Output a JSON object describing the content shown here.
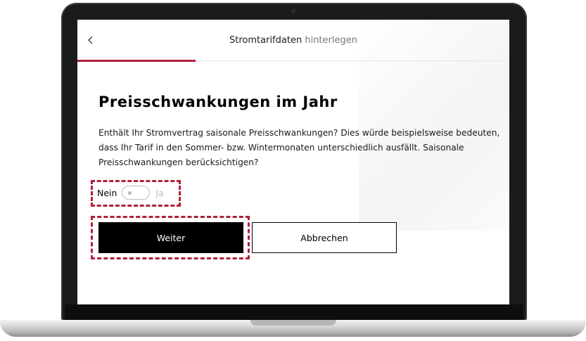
{
  "header": {
    "title_main": "Stromtarifdaten",
    "title_sub": "hinterlegen"
  },
  "icons": {
    "back": "chevron-left-icon"
  },
  "content": {
    "heading": "Preisschwankungen im Jahr",
    "description": "Enthält Ihr Stromvertrag saisonale Preisschwankungen? Dies würde beispielsweise bedeuten, dass Ihr Tarif in den Sommer- bzw. Wintermonaten unterschiedlich ausfällt. Saisonale Preisschwankungen berücksichtigen?"
  },
  "toggle": {
    "off_label": "Nein",
    "on_label": "Ja",
    "state": "Nein"
  },
  "buttons": {
    "primary_label": "Weiter",
    "secondary_label": "Abbrechen"
  },
  "colors": {
    "accent": "#b0203a",
    "primary_button": "#000000",
    "text": "#1a1a1a",
    "muted": "#bdbdbd"
  }
}
